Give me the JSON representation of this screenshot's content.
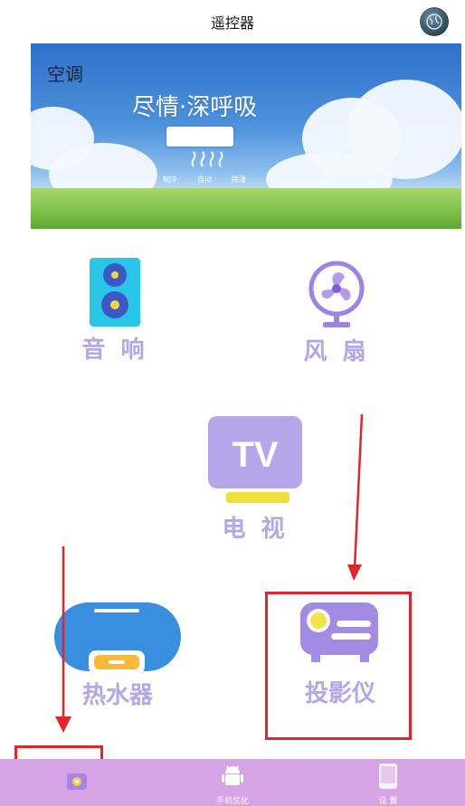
{
  "header": {
    "title": "遥控器"
  },
  "banner": {
    "device_label": "空调",
    "slogan": "尽情·深呼吸",
    "modes": [
      "制冷",
      "自动",
      "除湿"
    ]
  },
  "devices": {
    "speaker": "音 响",
    "fan": "风 扇",
    "tv": "电 视",
    "tv_screen_text": "TV",
    "water_heater": "热水器",
    "projector": "投影仪"
  },
  "tabbar": {
    "tabs": [
      {
        "label": ""
      },
      {
        "label": "手机优化"
      },
      {
        "label": "设 置"
      }
    ]
  },
  "colors": {
    "accent_purple": "#b5a6ea",
    "tabbar": "#d6a4e6",
    "annotation_red": "#e0262c"
  }
}
